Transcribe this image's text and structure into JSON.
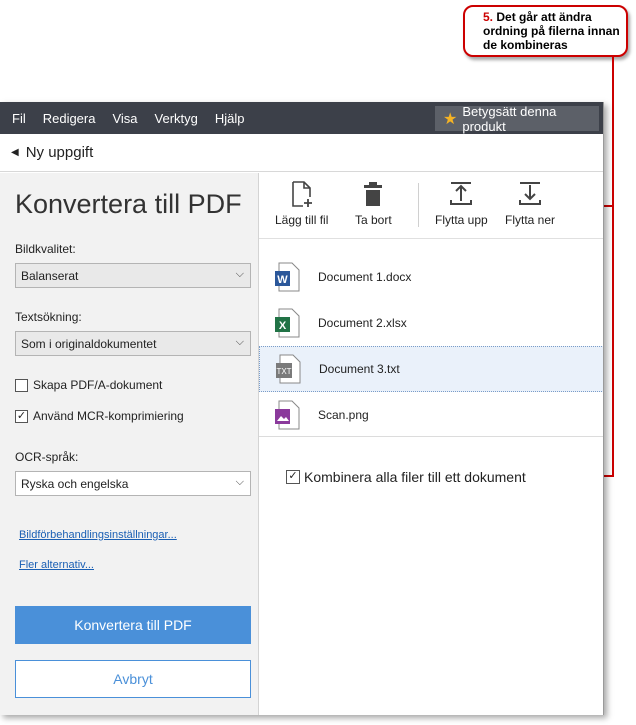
{
  "callout": {
    "number": "5.",
    "text": "Det går att ändra ordning på filerna innan de kombineras"
  },
  "menu": {
    "items": [
      "Fil",
      "Redigera",
      "Visa",
      "Verktyg",
      "Hjälp"
    ],
    "rate_label": "Betygsätt denna produkt"
  },
  "titlebar": {
    "title": "Ny uppgift"
  },
  "left": {
    "heading": "Konvertera till PDF",
    "image_quality_label": "Bildkvalitet:",
    "image_quality_value": "Balanserat",
    "text_search_label": "Textsökning:",
    "text_search_value": "Som i originaldokumentet",
    "pdfa_label": "Skapa PDF/A-dokument",
    "pdfa_checked": false,
    "mrc_label": "Använd MCR-komprimiering",
    "mrc_checked": true,
    "ocr_label": "OCR-språk:",
    "ocr_value": "Ryska och engelska",
    "preprocess_link": "Bildförbehandlingsinställningar...",
    "more_link": "Fler alternativ...",
    "convert_button": "Konvertera till PDF",
    "cancel_button": "Avbryt"
  },
  "toolbar": {
    "add": "Lägg till fil",
    "remove": "Ta bort",
    "move_up": "Flytta upp",
    "move_down": "Flytta ner"
  },
  "files": [
    {
      "name": "Document 1.docx",
      "icon": "word-file-icon",
      "color": "#2b579a"
    },
    {
      "name": "Document 2.xlsx",
      "icon": "excel-file-icon",
      "color": "#217346"
    },
    {
      "name": "Document 3.txt",
      "icon": "txt-file-icon",
      "color": "#7a7a7a",
      "selected": true
    },
    {
      "name": "Scan.png",
      "icon": "image-file-icon",
      "color": "#8b3a9c"
    }
  ],
  "combine": {
    "label": "Kombinera alla filer till ett dokument",
    "checked": true
  },
  "colors": {
    "accent": "#4a90d9",
    "callout": "#cc0000",
    "menubar": "#3c4049"
  }
}
